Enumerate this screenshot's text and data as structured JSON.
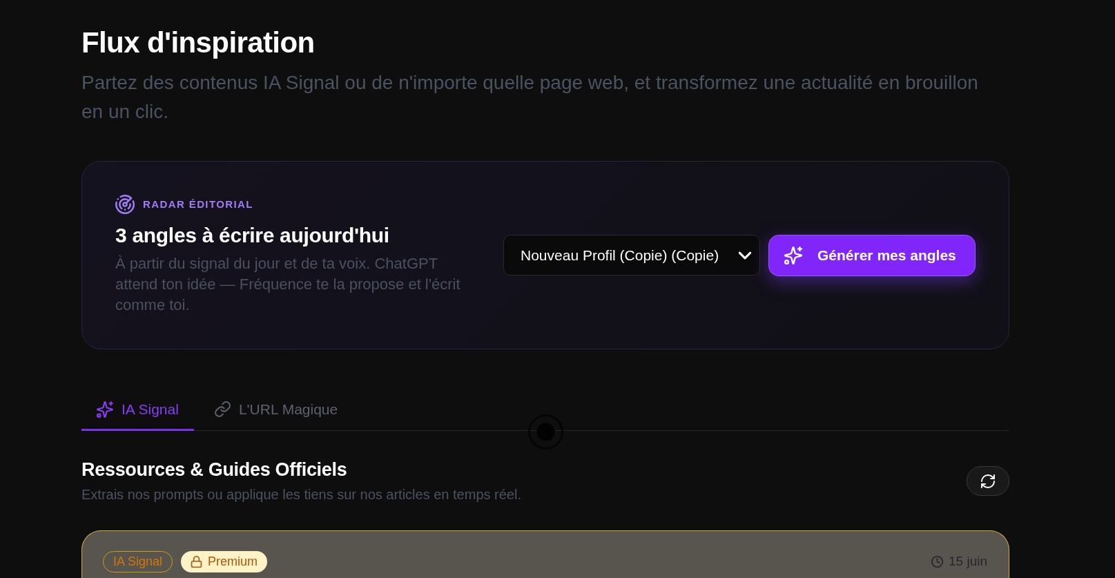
{
  "header": {
    "title": "Flux d'inspiration",
    "subtitle": "Partez des contenus IA Signal ou de n'importe quelle page web, et transformez une actualité en brouillon en un clic."
  },
  "radar": {
    "eyebrow": "RADAR ÉDITORIAL",
    "title": "3 angles à écrire aujourd'hui",
    "description": "À partir du signal du jour et de ta voix. ChatGPT attend ton idée — Fréquence te la propose et l'écrit comme toi.",
    "profile_select": {
      "value": "Nouveau Profil (Copie) (Copie)"
    },
    "generate_button": {
      "label": "Générer mes angles"
    }
  },
  "tabs": [
    {
      "kind": "signal",
      "label": "IA Signal",
      "selected": true
    },
    {
      "kind": "url",
      "label": "L'URL Magique",
      "selected": false
    }
  ],
  "section": {
    "title": "Ressources & Guides Officiels",
    "subtitle": "Extrais nos prompts ou applique les tiens sur nos articles en temps réel."
  },
  "articles": [
    {
      "tags": [
        {
          "kind": "source",
          "label": "IA Signal"
        },
        {
          "kind": "premium",
          "label": "Premium"
        }
      ],
      "date": "15 juin"
    }
  ]
}
